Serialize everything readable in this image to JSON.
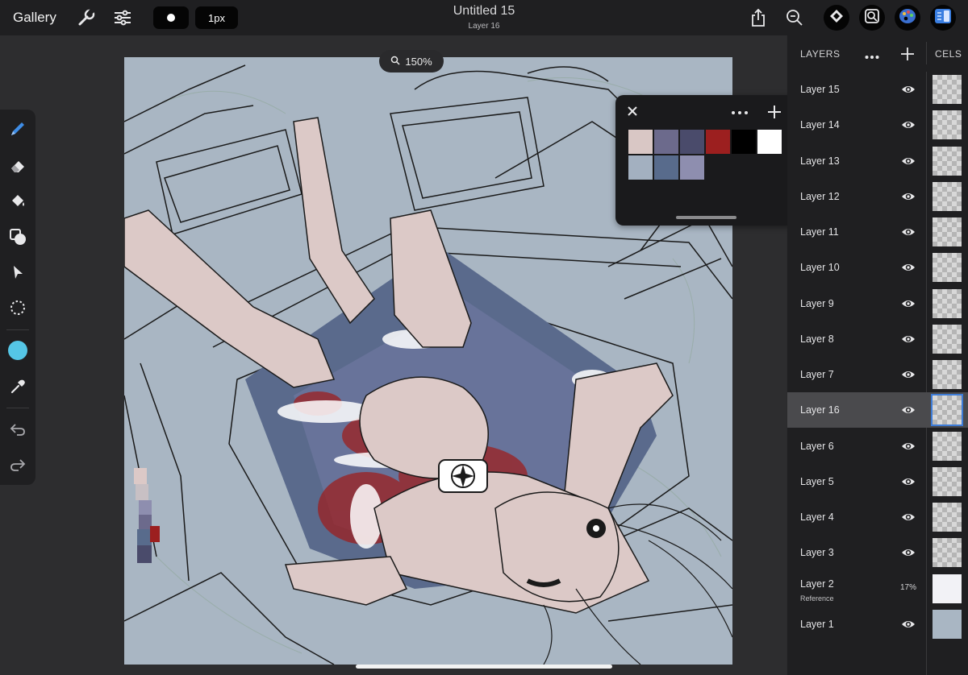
{
  "header": {
    "gallery_label": "Gallery",
    "brush_size_label": "1px",
    "title": "Untitled 15",
    "subtitle": "Layer 16",
    "icons": [
      "wrench-icon",
      "sliders-icon",
      "brush-shape-icon",
      "share-icon",
      "zoom-out-icon",
      "diamond-icon",
      "search-frame-icon",
      "color-palette-icon",
      "panel-toggle-icon"
    ]
  },
  "canvas": {
    "zoom_label": "150%",
    "background_color": "#a9b6c3"
  },
  "toolbar": {
    "tools": [
      "pencil-icon",
      "eraser-icon",
      "fill-bucket-icon",
      "shapes-icon",
      "select-arrow-icon",
      "lasso-select-icon",
      "current-color-icon",
      "eyedropper-icon",
      "undo-icon",
      "redo-icon"
    ],
    "current_color": "#55c6e6",
    "active_tool_color": "#3f8de6"
  },
  "palette": {
    "swatches": [
      "#d9c7c5",
      "#6c6a8c",
      "#4a4b6b",
      "#9c1f1f",
      "#000000",
      "#ffffff",
      "#a3b0c0",
      "#586b8c",
      "#8e8eaf"
    ]
  },
  "layers_panel": {
    "title": "LAYERS",
    "cels_label": "CELS",
    "layers": [
      {
        "name": "Layer 15",
        "sub": "",
        "opacity": "",
        "active": false
      },
      {
        "name": "Layer 14",
        "sub": "",
        "opacity": "",
        "active": false
      },
      {
        "name": "Layer 13",
        "sub": "",
        "opacity": "",
        "active": false
      },
      {
        "name": "Layer 12",
        "sub": "",
        "opacity": "",
        "active": false
      },
      {
        "name": "Layer 11",
        "sub": "",
        "opacity": "",
        "active": false
      },
      {
        "name": "Layer 10",
        "sub": "",
        "opacity": "",
        "active": false
      },
      {
        "name": "Layer 9",
        "sub": "",
        "opacity": "",
        "active": false
      },
      {
        "name": "Layer 8",
        "sub": "",
        "opacity": "",
        "active": false
      },
      {
        "name": "Layer 7",
        "sub": "",
        "opacity": "",
        "active": false
      },
      {
        "name": "Layer 16",
        "sub": "",
        "opacity": "",
        "active": true
      },
      {
        "name": "Layer 6",
        "sub": "",
        "opacity": "",
        "active": false
      },
      {
        "name": "Layer 5",
        "sub": "",
        "opacity": "",
        "active": false
      },
      {
        "name": "Layer 4",
        "sub": "",
        "opacity": "",
        "active": false
      },
      {
        "name": "Layer 3",
        "sub": "",
        "opacity": "",
        "active": false
      },
      {
        "name": "Layer 2",
        "sub": "Reference",
        "opacity": "17%",
        "active": false
      },
      {
        "name": "Layer 1",
        "sub": "",
        "opacity": "",
        "active": false
      }
    ]
  }
}
